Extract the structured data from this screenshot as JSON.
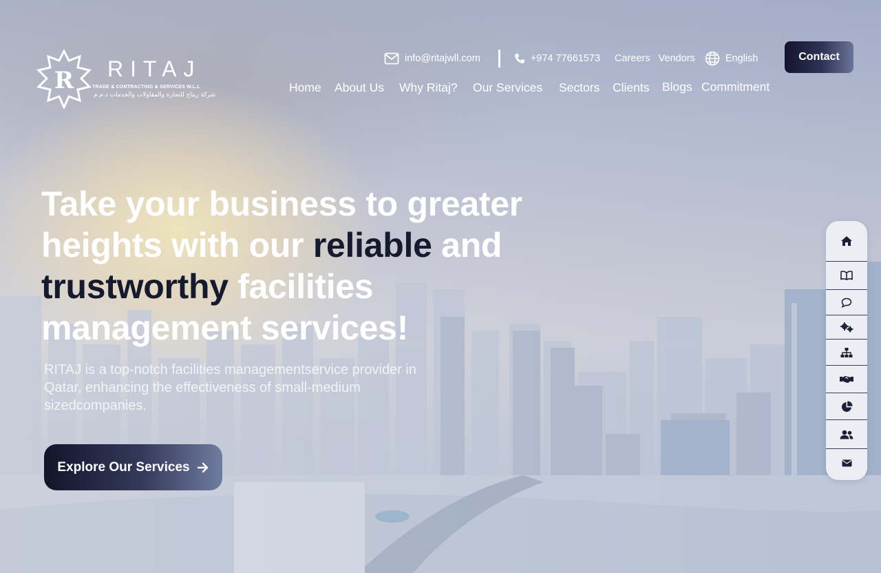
{
  "brand": {
    "name": "RITAJ",
    "tagline": "TRADE & CONTRACTING & SERVICES W.L.L",
    "tagline_ar": "شركة ريتاج للتجارة والمقاولات والخدمات ذ.م.م"
  },
  "topbar": {
    "email": "info@ritajwll.com",
    "phone": "+974 77661573",
    "careers": "Careers",
    "vendors": "Vendors",
    "language": "English"
  },
  "contact_button": "Contact",
  "nav": {
    "home": "Home",
    "about": "About Us",
    "why": "Why Ritaj?",
    "services": "Our Services",
    "sectors": "Sectors",
    "clients": "Clients",
    "blogs": "Blogs",
    "commitment": "Commitment"
  },
  "hero": {
    "l1": "Take your business to greater",
    "l2a": "heights with our ",
    "l2b": "reliable",
    "l2c": " and",
    "l3a": "trustworthy",
    "l3b": " facilities",
    "l4": "management services!",
    "description": "RITAJ is a top-notch facilities managementservice provider in Qatar, enhancing the effectiveness of small-medium sizedcompanies.",
    "cta": "Explore Our Services"
  },
  "rail": [
    "home-icon",
    "book-icon",
    "chat-icon",
    "gears-icon",
    "sitemap-icon",
    "handshake-icon",
    "pie-chart-icon",
    "users-icon",
    "envelope-icon"
  ],
  "colors": {
    "dark_navy": "#161a2e",
    "button_gradient_end": "#6f7c9e",
    "rail_bg": "#eceef3"
  }
}
